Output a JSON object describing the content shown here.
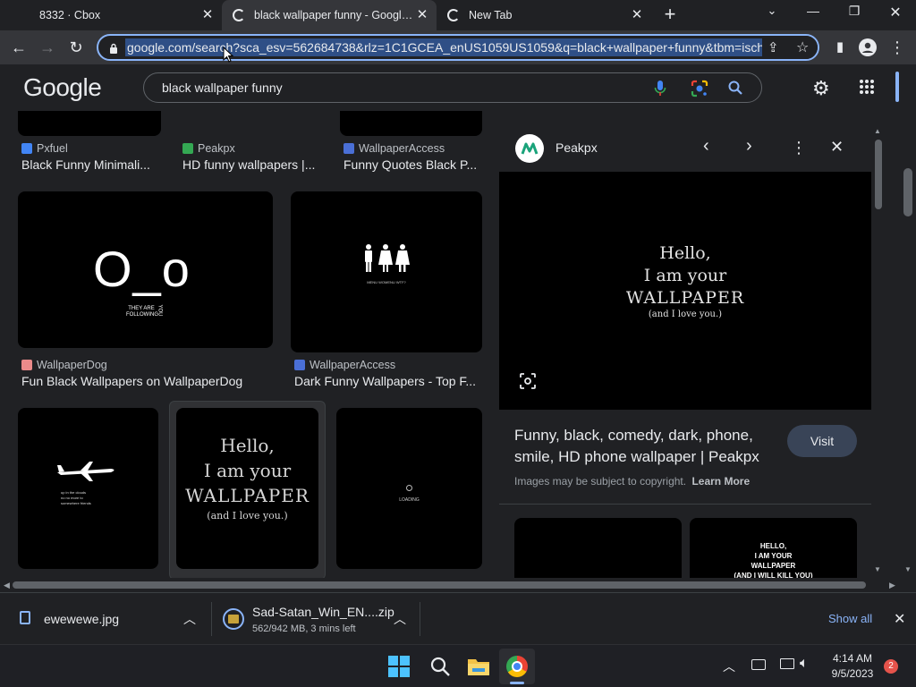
{
  "browser": {
    "tabs": [
      {
        "title": "8332 · Cbox",
        "active": false
      },
      {
        "title": "black wallpaper funny - Google Search",
        "active": true
      },
      {
        "title": "New Tab",
        "active": false
      }
    ],
    "new_tab_icon": "plus-icon",
    "url": "google.com/search?sca_esv=562684738&rlz=1C1GCEA_enUS1059US1059&q=black+wallpaper+funny&tbm=isch&"
  },
  "google": {
    "logo": "Google",
    "query": "black wallpaper funny"
  },
  "results": {
    "row1": [
      {
        "source": "Pxfuel",
        "caption": "Black Funny Minimali...",
        "fav_color": "#4285f4"
      },
      {
        "source": "Peakpx",
        "caption": "HD funny wallpapers |...",
        "fav_color": "#34a853"
      },
      {
        "source": "WallpaperAccess",
        "caption": "Funny Quotes Black P...",
        "fav_color": "#4a6fd6"
      }
    ],
    "row2": [
      {
        "source": "WallpaperDog",
        "caption": "Fun Black Wallpapers on WallpaperDog",
        "fav_color": "#ea8a8a",
        "thumb_big": "O_o",
        "thumb_small": "THEY ARE FOLLOWING",
        "thumb_rot": "YOU"
      },
      {
        "source": "WallpaperAccess",
        "caption": "Dark Funny Wallpapers - Top F...",
        "fav_color": "#4a6fd6",
        "thumb_small": "MENU   WOMENU   WTF?"
      }
    ],
    "row3": [
      {
        "thumb_text": "up in the clouds\nno no more to\nsomewhere friends"
      },
      {
        "line1": "Hello,",
        "line2": "I am your",
        "line3": "WALLPAPER",
        "line4": "(and I love you.)"
      },
      {
        "thumb_text": "LOADING"
      }
    ]
  },
  "panel": {
    "site": "Peakpx",
    "image": {
      "line1": "Hello,",
      "line2": "I am your",
      "line3": "WALLPAPER",
      "line4": "(and I love you.)"
    },
    "title": "Funny, black, comedy, dark, phone, smile, HD phone wallpaper | Peakpx",
    "copyright": "Images may be subject to copyright.",
    "learn_more": "Learn More",
    "visit": "Visit",
    "related_text": "HELLO,\nI AM YOUR\nWALLPAPER\n(AND I WILL KILL YOU)"
  },
  "downloads": [
    {
      "name": "ewewewe.jpg",
      "status": ""
    },
    {
      "name": "Sad-Satan_Win_EN....zip",
      "status": "562/942 MB, 3 mins left"
    }
  ],
  "downloads_show_all": "Show all",
  "taskbar": {
    "time": "4:14 AM",
    "date": "9/5/2023",
    "notifications": "2"
  }
}
